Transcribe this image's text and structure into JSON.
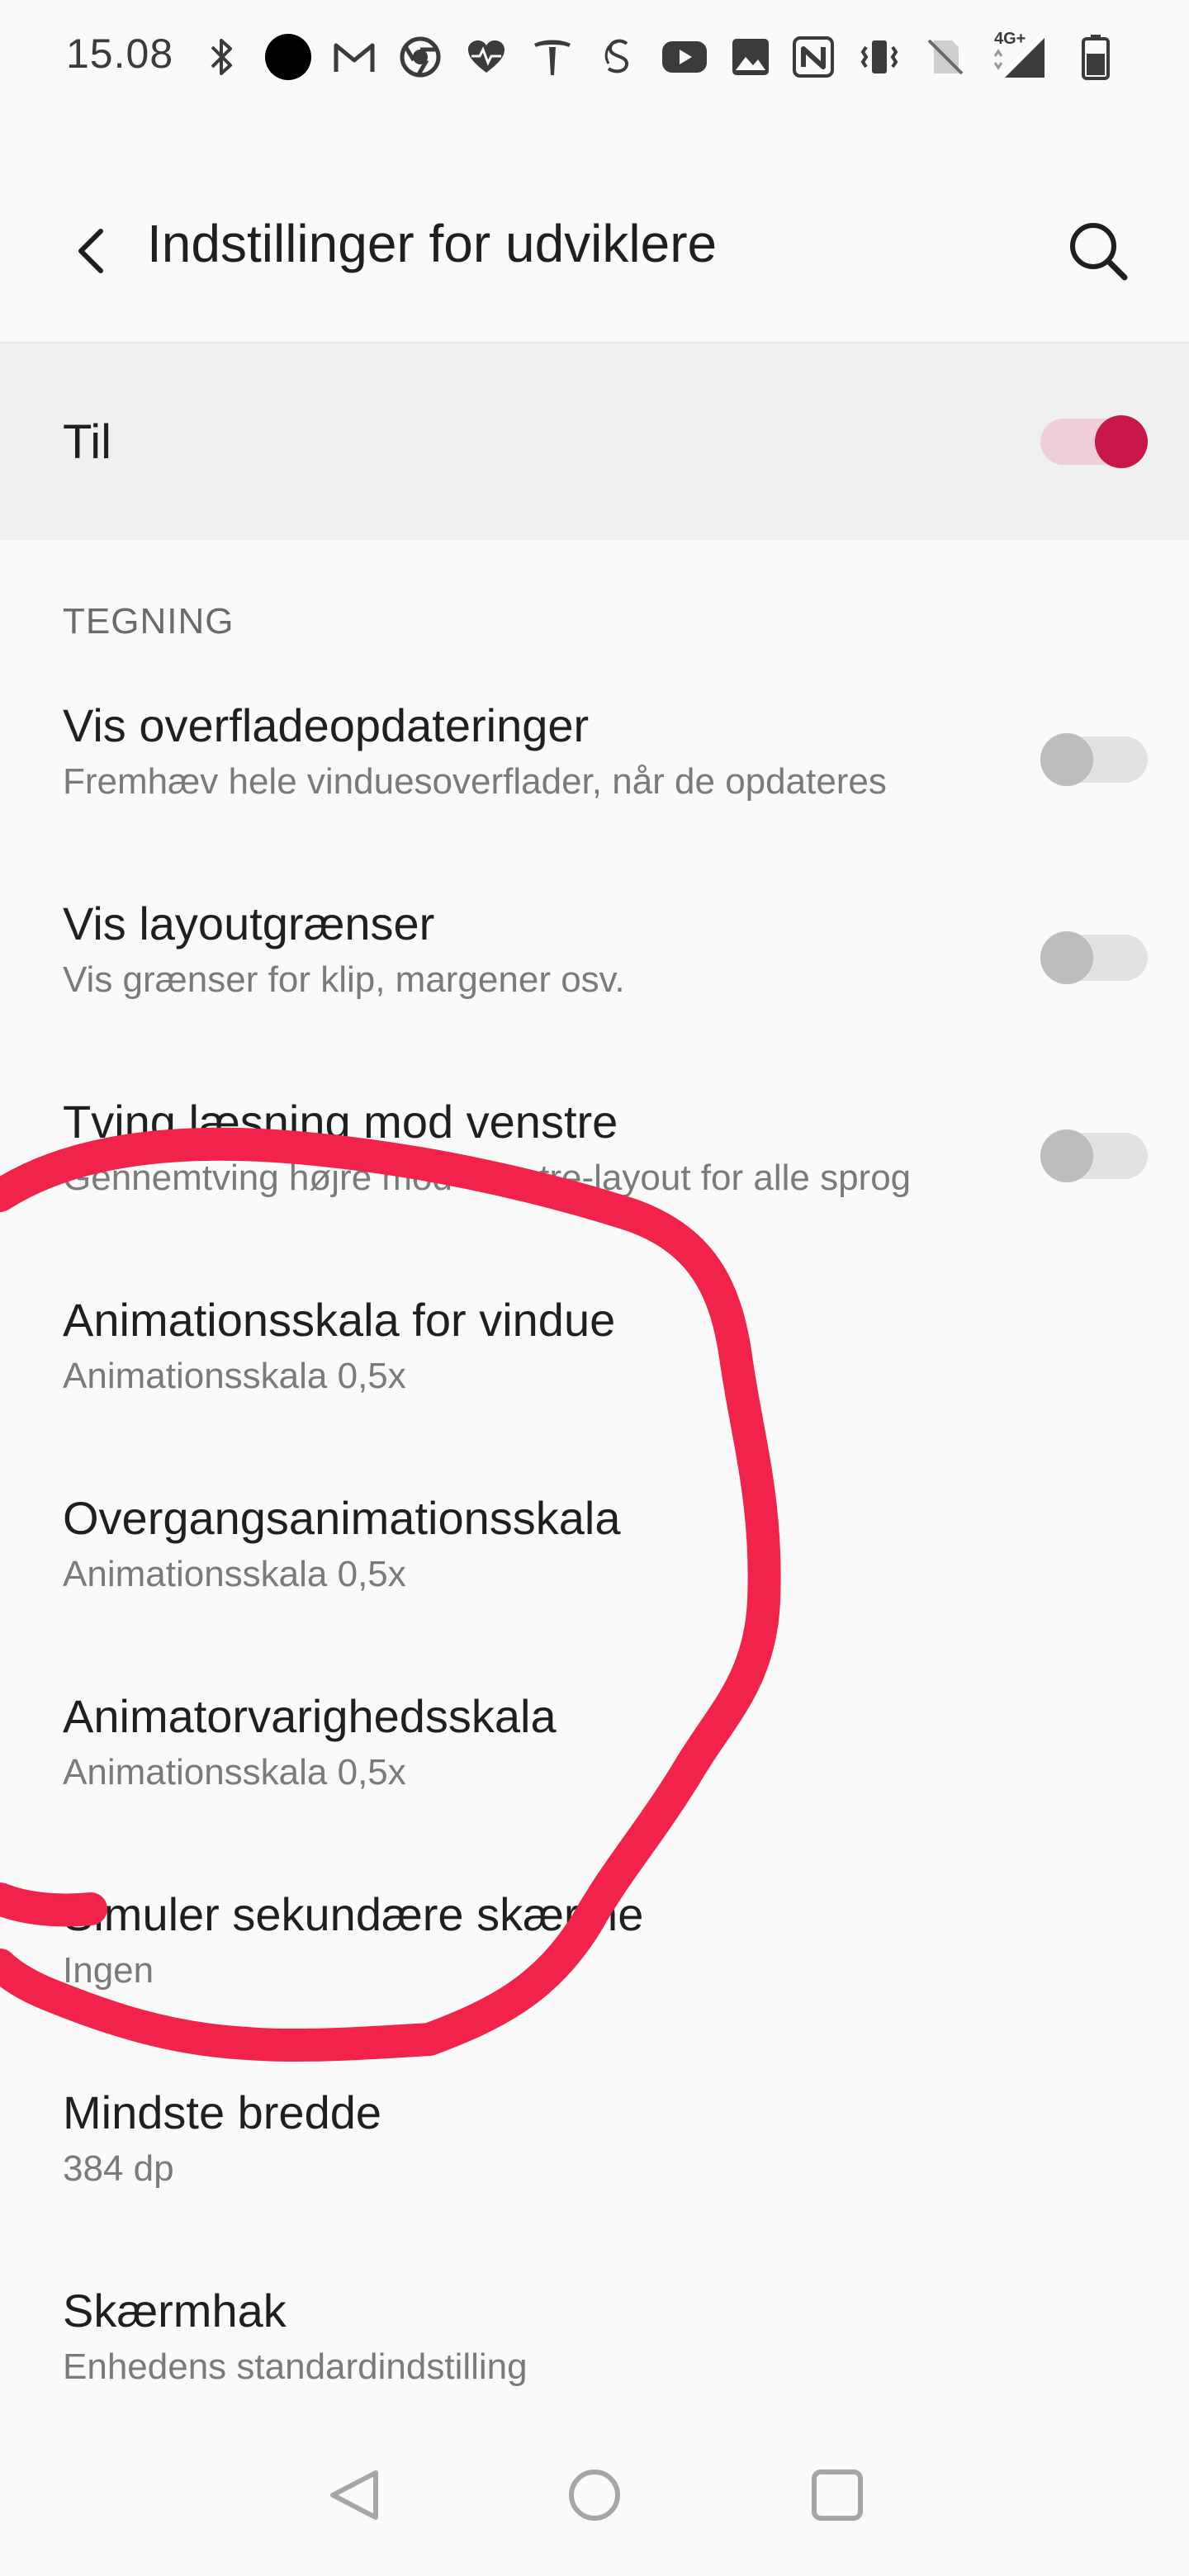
{
  "status_bar": {
    "time": "15.08",
    "network_label": "4G+",
    "left_icons": [
      "bluetooth-icon",
      "dot-icon",
      "gmail-icon",
      "chrome-icon",
      "health-icon",
      "tesla-icon",
      "app-s-icon",
      "youtube-icon",
      "gallery-icon"
    ],
    "right_icons": [
      "nfc-icon",
      "vibrate-icon",
      "no-sim-icon",
      "signal-icon",
      "battery-icon"
    ]
  },
  "app_bar": {
    "title": "Indstillinger for udviklere",
    "back_icon": "back-arrow-icon",
    "search_icon": "search-icon"
  },
  "master_toggle": {
    "label": "Til",
    "state": "on"
  },
  "section": {
    "header": "TEGNING"
  },
  "settings": [
    {
      "title": "Vis overfladeopdateringer",
      "subtitle": "Fremhæv hele vinduesoverflader, når de opdateres",
      "toggle": "off"
    },
    {
      "title": "Vis layoutgrænser",
      "subtitle": "Vis grænser for klip, margener osv.",
      "toggle": "off"
    },
    {
      "title": "Tving læsning mod venstre",
      "subtitle": "Gennemtving højre mod venstre-layout for alle sprog",
      "toggle": "off"
    },
    {
      "title": "Animationsskala for vindue",
      "subtitle": "Animationsskala 0,5x"
    },
    {
      "title": "Overgangsanimationsskala",
      "subtitle": "Animationsskala 0,5x"
    },
    {
      "title": "Animatorvarighedsskala",
      "subtitle": "Animationsskala 0,5x"
    },
    {
      "title": "Simuler sekundære skærme",
      "subtitle": "Ingen"
    },
    {
      "title": "Mindste bredde",
      "subtitle": "384 dp"
    },
    {
      "title": "Skærmhak",
      "subtitle": "Enhedens standardindstilling"
    }
  ],
  "colors": {
    "accent": "#c8184a",
    "accent_track": "#f1cfd8",
    "annotation": "#f2234a",
    "background": "#fafafa"
  },
  "nav_bar": {
    "icons": [
      "nav-back-icon",
      "nav-home-icon",
      "nav-recents-icon"
    ]
  }
}
